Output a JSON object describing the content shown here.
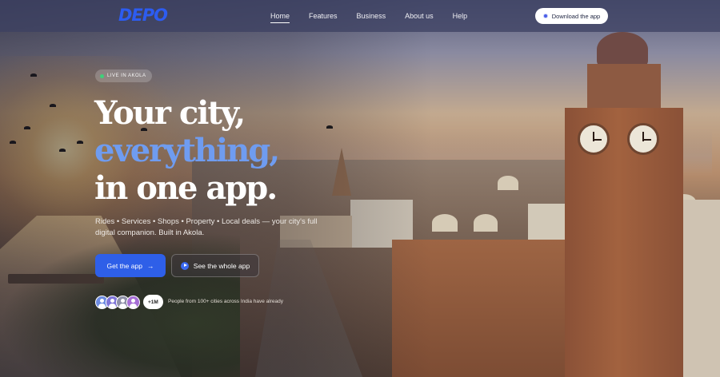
{
  "brand": {
    "logo_text": "DEPO",
    "logo_color": "#2d5cf0"
  },
  "nav": {
    "links": [
      {
        "label": "Home",
        "active": true
      },
      {
        "label": "Features",
        "active": false
      },
      {
        "label": "Business",
        "active": false
      },
      {
        "label": "About us",
        "active": false
      },
      {
        "label": "Help",
        "active": false
      }
    ],
    "download_label": "Download the app"
  },
  "hero": {
    "live_badge": "LIVE IN AKOLA",
    "headline_line1": "Your city,",
    "headline_line2": "everything,",
    "headline_line3": "in one app.",
    "highlight_color": "#6f9cf0",
    "subtitle": "Rides • Services • Shops • Property • Local deals — your city's full digital companion. Built in Akola.",
    "primary_cta": "Get the app",
    "secondary_cta": "See the whole app",
    "user_count": "+1M",
    "social_proof": "People from 100+ cities across India have already"
  },
  "icons": {
    "primary_cta_icon": "arrow-right-icon",
    "secondary_cta_icon": "play-icon",
    "download_icon": "dot-icon"
  }
}
